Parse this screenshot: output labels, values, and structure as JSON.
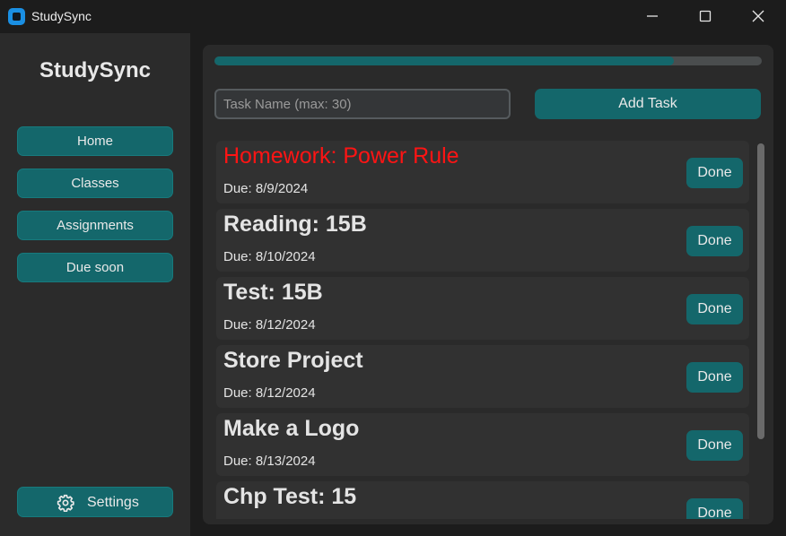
{
  "window": {
    "title": "StudySync"
  },
  "sidebar": {
    "brand": "StudySync",
    "nav": [
      {
        "label": "Home"
      },
      {
        "label": "Classes"
      },
      {
        "label": "Assignments"
      },
      {
        "label": "Due soon"
      }
    ],
    "settings_label": "Settings"
  },
  "main": {
    "progress_percent": 84,
    "task_input": {
      "placeholder": "Task Name (max: 30)",
      "value": ""
    },
    "add_button_label": "Add Task",
    "tasks": [
      {
        "name": "Homework: Power Rule",
        "due": "Due: 8/9/2024",
        "done_label": "Done",
        "overdue": true
      },
      {
        "name": "Reading: 15B",
        "due": "Due: 8/10/2024",
        "done_label": "Done",
        "overdue": false
      },
      {
        "name": "Test: 15B",
        "due": "Due: 8/12/2024",
        "done_label": "Done",
        "overdue": false
      },
      {
        "name": "Store Project",
        "due": "Due: 8/12/2024",
        "done_label": "Done",
        "overdue": false
      },
      {
        "name": "Make a Logo",
        "due": "Due: 8/13/2024",
        "done_label": "Done",
        "overdue": false
      },
      {
        "name": "Chp Test: 15",
        "due": "",
        "done_label": "Done",
        "overdue": false
      }
    ]
  },
  "colors": {
    "accent": "#14676b",
    "overdue": "#ff1414",
    "background": "#1c1c1c",
    "panel": "#2b2b2b"
  },
  "icons": {
    "app": "app-icon",
    "settings": "gear-icon",
    "minimize": "minimize-icon",
    "maximize": "maximize-icon",
    "close": "close-icon"
  }
}
